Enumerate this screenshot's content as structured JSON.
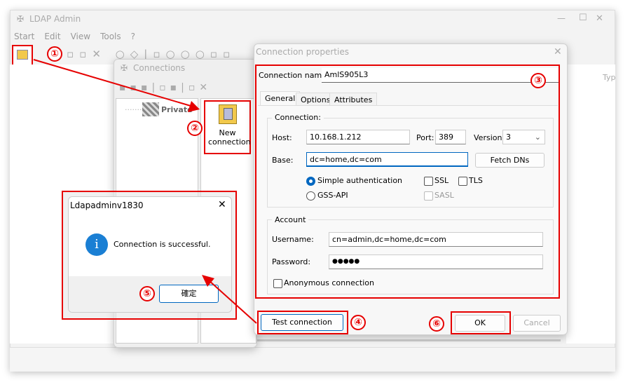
{
  "main_window": {
    "title": "LDAP Admin",
    "menu": [
      "Start",
      "Edit",
      "View",
      "Tools",
      "?"
    ],
    "controls": {
      "minimize": "—",
      "maximize": "☐",
      "close": "✕"
    },
    "column_header": "Typ"
  },
  "connections_window": {
    "title": "Connections",
    "tree_item": "Private",
    "new_connection_label": "New connection"
  },
  "connection_properties": {
    "title": "Connection properties",
    "close": "✕",
    "connection_name_label": "Connection name:",
    "connection_name_value": "AmlS905L3",
    "tabs": [
      {
        "label": "General",
        "active": true
      },
      {
        "label": "Options"
      },
      {
        "label": "Attributes"
      }
    ],
    "connection_group": {
      "legend": "Connection:",
      "host_label": "Host:",
      "host_value": "10.168.1.212",
      "port_label": "Port:",
      "port_value": "389",
      "version_label": "Version:",
      "version_value": "3",
      "base_label": "Base:",
      "base_value": "dc=home,dc=com",
      "fetch_dns": "Fetch DNs",
      "simple_auth": "Simple authentication",
      "gss_api": "GSS-API",
      "auth_selected": "Simple authentication",
      "ssl": "SSL",
      "tls": "TLS",
      "sasl": "SASL"
    },
    "account_group": {
      "legend": "Account",
      "username_label": "Username:",
      "username_value": "cn=admin,dc=home,dc=com",
      "password_label": "Password:",
      "password_value": "●●●●●",
      "anonymous": "Anonymous connection"
    },
    "test_connection": "Test connection",
    "ok": "OK",
    "cancel": "Cancel"
  },
  "message_box": {
    "title": "Ldapadminv1830",
    "close": "✕",
    "message": "Connection is successful.",
    "ok": "確定",
    "icon": "info-icon"
  },
  "annotations": {
    "step1": "①",
    "step2": "②",
    "step3": "③",
    "step4": "④",
    "step5": "⑤",
    "step6": "⑥",
    "color": "#e60000"
  }
}
